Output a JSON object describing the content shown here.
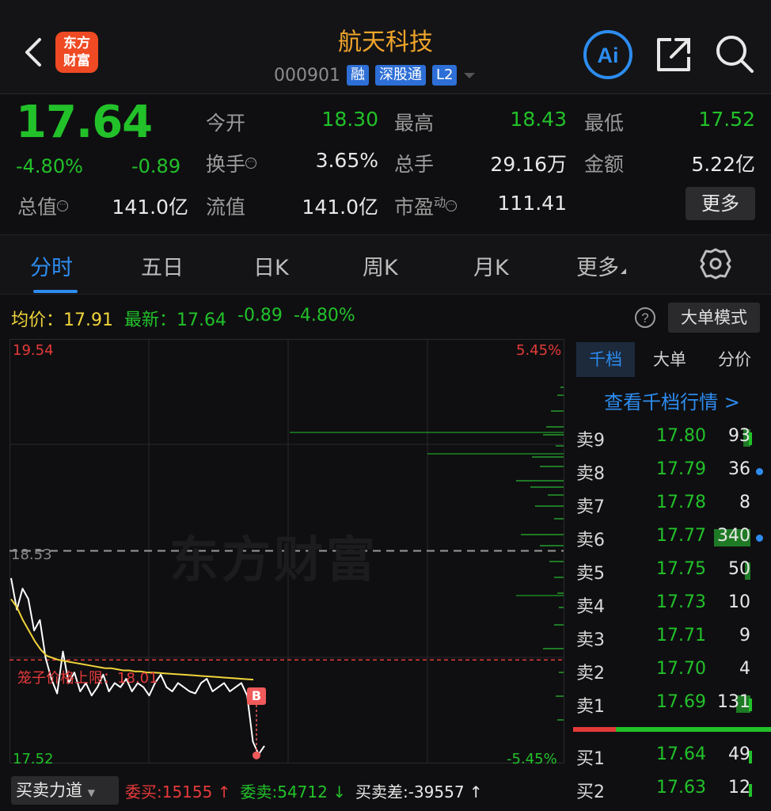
{
  "header": {
    "title": "航天科技",
    "code": "000901",
    "tags": [
      "融",
      "深股通",
      "L2"
    ],
    "logo_line1": "东方",
    "logo_line2": "财富",
    "ai_label": "Ai"
  },
  "quote": {
    "price": "17.64",
    "pct": "-4.80%",
    "change": "-0.89",
    "total_value_label": "总值",
    "total_value": "141.0亿",
    "open_label": "今开",
    "open": "18.30",
    "high_label": "最高",
    "high": "18.43",
    "low_label": "最低",
    "low": "17.52",
    "turnover_label": "换手",
    "turnover": "3.65%",
    "volume_label": "总手",
    "volume": "29.16万",
    "amount_label": "金额",
    "amount": "5.22亿",
    "float_label": "流值",
    "float": "141.0亿",
    "pe_label": "市盈",
    "pe_sup": "动",
    "pe": "111.41",
    "more_label": "更多"
  },
  "tabs": [
    "分时",
    "五日",
    "日K",
    "周K",
    "月K",
    "更多"
  ],
  "summary": {
    "avg_label": "均价：",
    "avg": "17.91",
    "latest_label": "最新：",
    "latest": "17.64",
    "change": "-0.89",
    "pct": "-4.80%",
    "big_mode_label": "大单模式"
  },
  "chart": {
    "top_price": "19.54",
    "bottom_price": "17.52",
    "top_pct": "5.45%",
    "bottom_pct": "-5.45%",
    "prev_close": "18.53",
    "limit_label": "笼子价格上限：18.01",
    "watermark": "东方财富",
    "b_mark": "B"
  },
  "chart_data": {
    "type": "line",
    "ylim": [
      17.52,
      19.54
    ],
    "prev_close": 18.53,
    "limit_line": 18.01,
    "series": [
      {
        "values": [
          18.4,
          18.25,
          18.35,
          18.3,
          18.15,
          18.2,
          18.02,
          17.92,
          17.85,
          18.05,
          17.9,
          17.95,
          17.86,
          17.9,
          17.84,
          17.88,
          17.94,
          17.86,
          17.9,
          17.88,
          17.92,
          17.86,
          17.9,
          17.88,
          17.84,
          17.9,
          17.94,
          17.88,
          17.86,
          17.9,
          17.88,
          17.86,
          17.85,
          17.9,
          17.92,
          17.86,
          17.88,
          17.9,
          17.86,
          17.88,
          17.9,
          17.84,
          17.62,
          17.56,
          17.6
        ]
      },
      {
        "values": [
          18.3,
          18.26,
          18.2,
          18.15,
          18.1,
          18.06,
          18.03,
          18.02,
          18.01,
          18.005,
          18.0,
          17.995,
          17.99,
          17.985,
          17.98,
          17.975,
          17.97,
          17.97,
          17.965,
          17.96,
          17.96,
          17.955,
          17.955,
          17.95,
          17.95,
          17.948,
          17.946,
          17.944,
          17.942,
          17.94,
          17.938,
          17.936,
          17.934,
          17.932,
          17.93,
          17.928,
          17.926,
          17.924,
          17.922,
          17.92,
          17.918,
          17.916
        ]
      }
    ]
  },
  "book": {
    "tabs": [
      "千档",
      "大单",
      "分价"
    ],
    "view_depth": "查看千档行情 >",
    "asks": [
      {
        "label": "卖9",
        "price": "17.80",
        "vol": "93",
        "bar": 0.08,
        "dot": false,
        "tick": true
      },
      {
        "label": "卖8",
        "price": "17.79",
        "vol": "36",
        "bar": 0,
        "dot": true,
        "tick": false
      },
      {
        "label": "卖7",
        "price": "17.78",
        "vol": "8",
        "bar": 0,
        "dot": false,
        "tick": false
      },
      {
        "label": "卖6",
        "price": "17.77",
        "vol": "340",
        "bar": 0.42,
        "dot": true,
        "tick": false
      },
      {
        "label": "卖5",
        "price": "17.75",
        "vol": "50",
        "bar": 0.06,
        "dot": false,
        "tick": false
      },
      {
        "label": "卖4",
        "price": "17.73",
        "vol": "10",
        "bar": 0,
        "dot": false,
        "tick": false
      },
      {
        "label": "卖3",
        "price": "17.71",
        "vol": "9",
        "bar": 0,
        "dot": false,
        "tick": false
      },
      {
        "label": "卖2",
        "price": "17.70",
        "vol": "4",
        "bar": 0,
        "dot": false,
        "tick": false
      },
      {
        "label": "卖1",
        "price": "17.69",
        "vol": "131",
        "bar": 0.16,
        "dot": false,
        "tick": true
      }
    ],
    "bids": [
      {
        "label": "买1",
        "price": "17.64",
        "vol": "49",
        "bar": 0,
        "dot": false,
        "tick": true
      },
      {
        "label": "买2",
        "price": "17.63",
        "vol": "12",
        "bar": 0,
        "dot": false,
        "tick": true
      }
    ]
  },
  "bottom": {
    "force_label": "买卖力道",
    "bid_label": "委买:15155 ↑",
    "ask_label": "委卖:54712 ↓",
    "diff_label": "买卖差:-39557 ↑"
  },
  "colors": {
    "up": "#e53a3a",
    "down": "#22c12a",
    "accent": "#2d8cf0",
    "title": "#f0a52a",
    "avg_line": "#f0d43a"
  }
}
